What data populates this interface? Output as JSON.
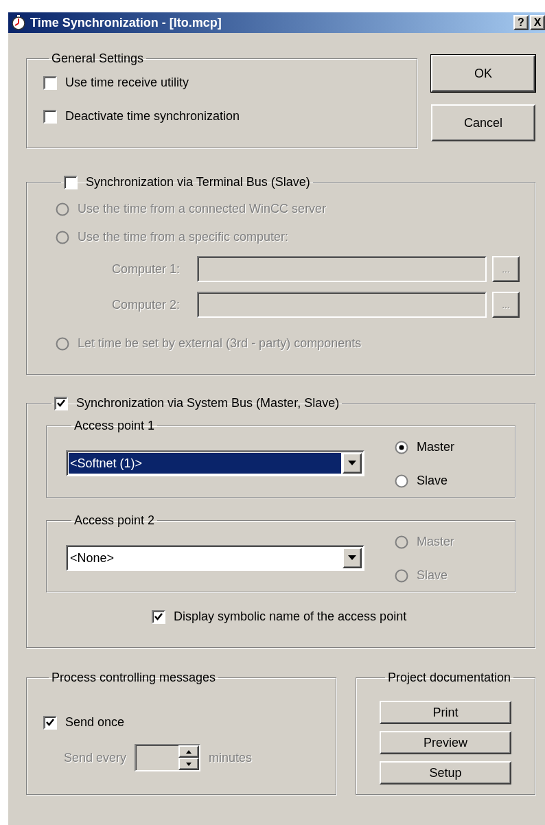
{
  "window": {
    "title": "Time Synchronization - [lto.mcp]",
    "title_buttons": [
      "?",
      "X"
    ]
  },
  "general_settings": {
    "title": "General Settings",
    "options": [
      {
        "label": "Use time receive utility",
        "checked": false
      },
      {
        "label": "Deactivate time synchronization",
        "checked": false
      }
    ]
  },
  "dialog_buttons": [
    "OK",
    "Cancel"
  ],
  "terminal_bus": {
    "label": "Synchronization via Terminal Bus (Slave)",
    "checked": false,
    "items": [
      {
        "kind": "radio",
        "label": "Use the time from a connected WinCC server",
        "selected": false,
        "disabled": true
      },
      {
        "kind": "radio",
        "label": "Use the time from a specific computer:",
        "selected": false,
        "disabled": true
      },
      {
        "kind": "field",
        "label": "Computer 1:",
        "browse": "...",
        "disabled": true
      },
      {
        "kind": "field",
        "label": "Computer 2:",
        "browse": "...",
        "disabled": true
      },
      {
        "kind": "radio",
        "label": "Let time be set by external (3rd - party) components",
        "selected": false,
        "disabled": true
      }
    ]
  },
  "system_bus": {
    "label": "Synchronization via System Bus (Master, Slave)",
    "checked": true,
    "access_points": [
      {
        "title": "Access point 1",
        "value": "<Softnet (1)>",
        "highlighted": true,
        "roles": [
          {
            "label": "Master",
            "selected": true,
            "disabled": false
          },
          {
            "label": "Slave",
            "selected": false,
            "disabled": false
          }
        ]
      },
      {
        "title": "Access point 2",
        "value": "<None>",
        "highlighted": false,
        "roles": [
          {
            "label": "Master",
            "selected": false,
            "disabled": true
          },
          {
            "label": "Slave",
            "selected": false,
            "disabled": true
          }
        ]
      }
    ],
    "symbolic": {
      "label": "Display symbolic name of the access point",
      "checked": true
    }
  },
  "process_messages": {
    "title": "Process controlling messages",
    "send_once": {
      "label": "Send once",
      "checked": true
    },
    "send_every": {
      "label": "Send every",
      "unit": "minutes",
      "disabled": true
    }
  },
  "project_documentation": {
    "title": "Project documentation",
    "buttons": [
      "Print",
      "Preview",
      "Setup"
    ]
  }
}
